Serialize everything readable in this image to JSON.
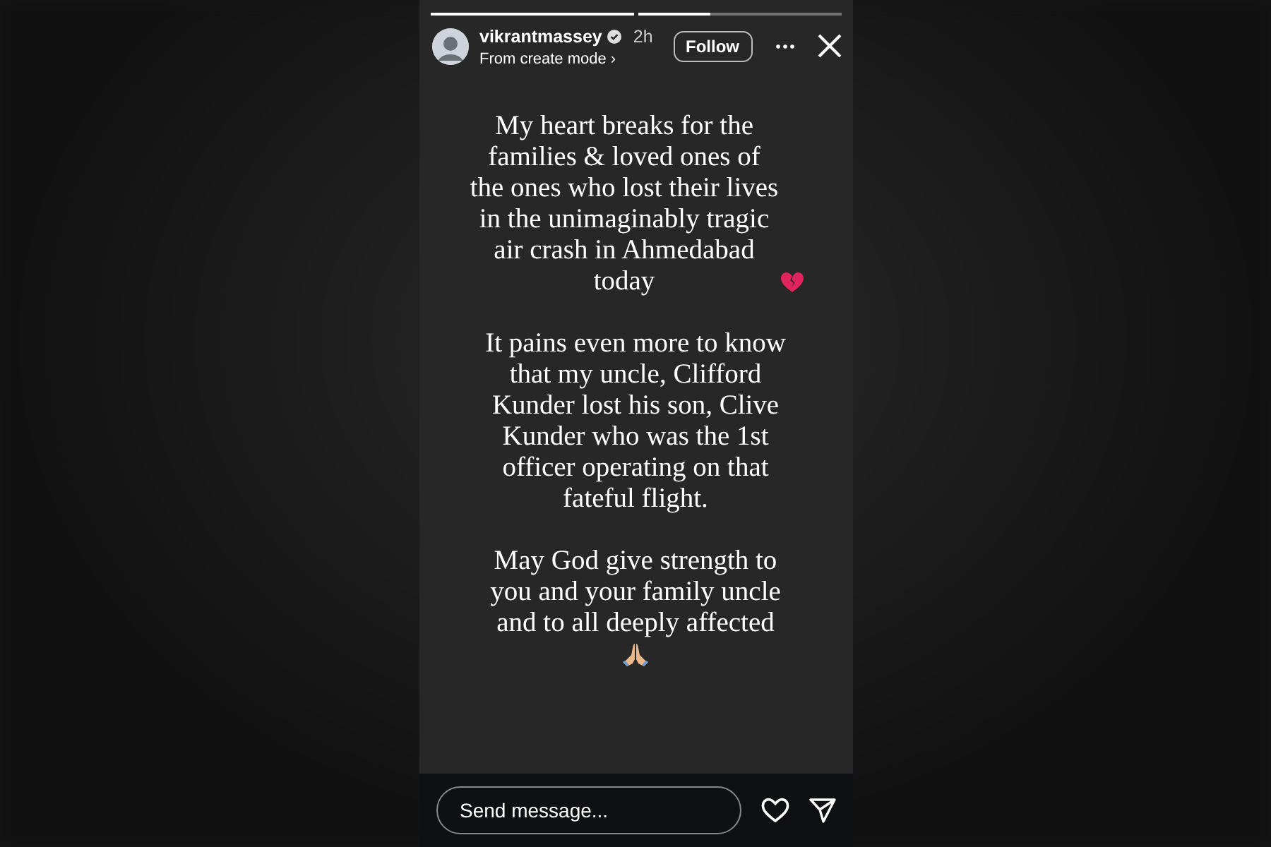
{
  "story": {
    "progress": [
      {
        "level": 1
      },
      {
        "level": 0.36
      }
    ],
    "header": {
      "username": "vikrantmassey",
      "verified": true,
      "time": "2h",
      "subtitle": "From create mode ›",
      "follow": "Follow"
    },
    "paragraphs": [
      {
        "text": "My heart breaks for the families & loved ones of the ones who lost their lives in the unimaginably tragic air crash in Ahmedabad today",
        "kind": "heartbreak"
      },
      {
        "text": "It pains even more to know that my uncle, Clifford Kunder lost his son, Clive Kunder who was the 1st officer operating on that fateful flight.",
        "kind": "plain"
      },
      {
        "text": "May God give strength to you and your family uncle and to all deeply affected",
        "kind": "prayer"
      }
    ],
    "footer": {
      "placeholder": "Send message..."
    }
  }
}
